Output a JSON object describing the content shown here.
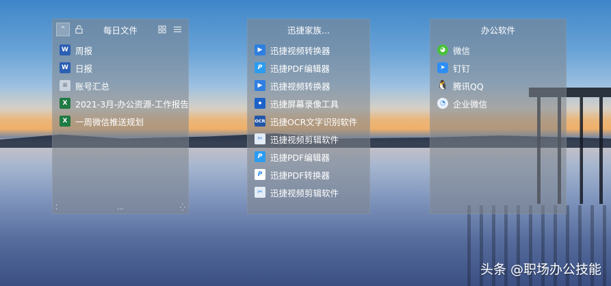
{
  "fences": [
    {
      "title": "每日文件",
      "toolbar": {
        "collapse_icon": "⌃",
        "lock_icon": "🔓",
        "grid_icon": "▦",
        "menu_icon": "☰"
      },
      "items": [
        {
          "icon": "word-icon",
          "glyph": "W",
          "label": "周报"
        },
        {
          "icon": "word-icon",
          "glyph": "W",
          "label": "日报"
        },
        {
          "icon": "notepad-icon",
          "glyph": "≡",
          "label": "账号汇总"
        },
        {
          "icon": "excel-icon",
          "glyph": "X",
          "label": "2021-3月-办公资源-工作报告"
        },
        {
          "icon": "excel-icon",
          "glyph": "X",
          "label": "一周微信推送规划"
        }
      ],
      "footer": {
        "left": "⁚",
        "mid": "…",
        "right": "⁛"
      }
    },
    {
      "title": "迅捷家族...",
      "items": [
        {
          "icon": "xunjie-video-converter-icon",
          "glyph": "▶",
          "label": "迅捷视频转换器"
        },
        {
          "icon": "xunjie-pdf-editor-icon",
          "glyph": "P",
          "label": "迅捷PDF编辑器"
        },
        {
          "icon": "xunjie-video-converter-icon",
          "glyph": "▶",
          "label": "迅捷视频转换器"
        },
        {
          "icon": "xunjie-screen-recorder-icon",
          "glyph": "⏺",
          "label": "迅捷屏幕录像工具"
        },
        {
          "icon": "xunjie-ocr-icon",
          "glyph": "OCR",
          "label": "迅捷OCR文字识别软件"
        },
        {
          "icon": "xunjie-video-editor-icon",
          "glyph": "✂",
          "label": "迅捷视频剪辑软件"
        },
        {
          "icon": "xunjie-pdf-editor-icon",
          "glyph": "P",
          "label": "迅捷PDF编辑器"
        },
        {
          "icon": "xunjie-pdf-converter-icon",
          "glyph": "P",
          "label": "迅捷PDF转换器"
        },
        {
          "icon": "xunjie-video-editor-icon",
          "glyph": "✂",
          "label": "迅捷视频剪辑软件"
        }
      ]
    },
    {
      "title": "办公软件",
      "items": [
        {
          "icon": "wechat-icon",
          "glyph": "◕",
          "label": "微信"
        },
        {
          "icon": "dingtalk-icon",
          "glyph": "➤",
          "label": "钉钉"
        },
        {
          "icon": "qq-penguin-icon",
          "glyph": "🐧",
          "label": "腾讯QQ"
        },
        {
          "icon": "wework-icon",
          "glyph": "◔",
          "label": "企业微信"
        }
      ]
    }
  ],
  "watermark": "头条 @职场办公技能",
  "colors": {
    "fence_bg": "#80858c",
    "sky_top": "#3e86c9",
    "sunset": "#f0b06a",
    "water": "#566c9c"
  }
}
